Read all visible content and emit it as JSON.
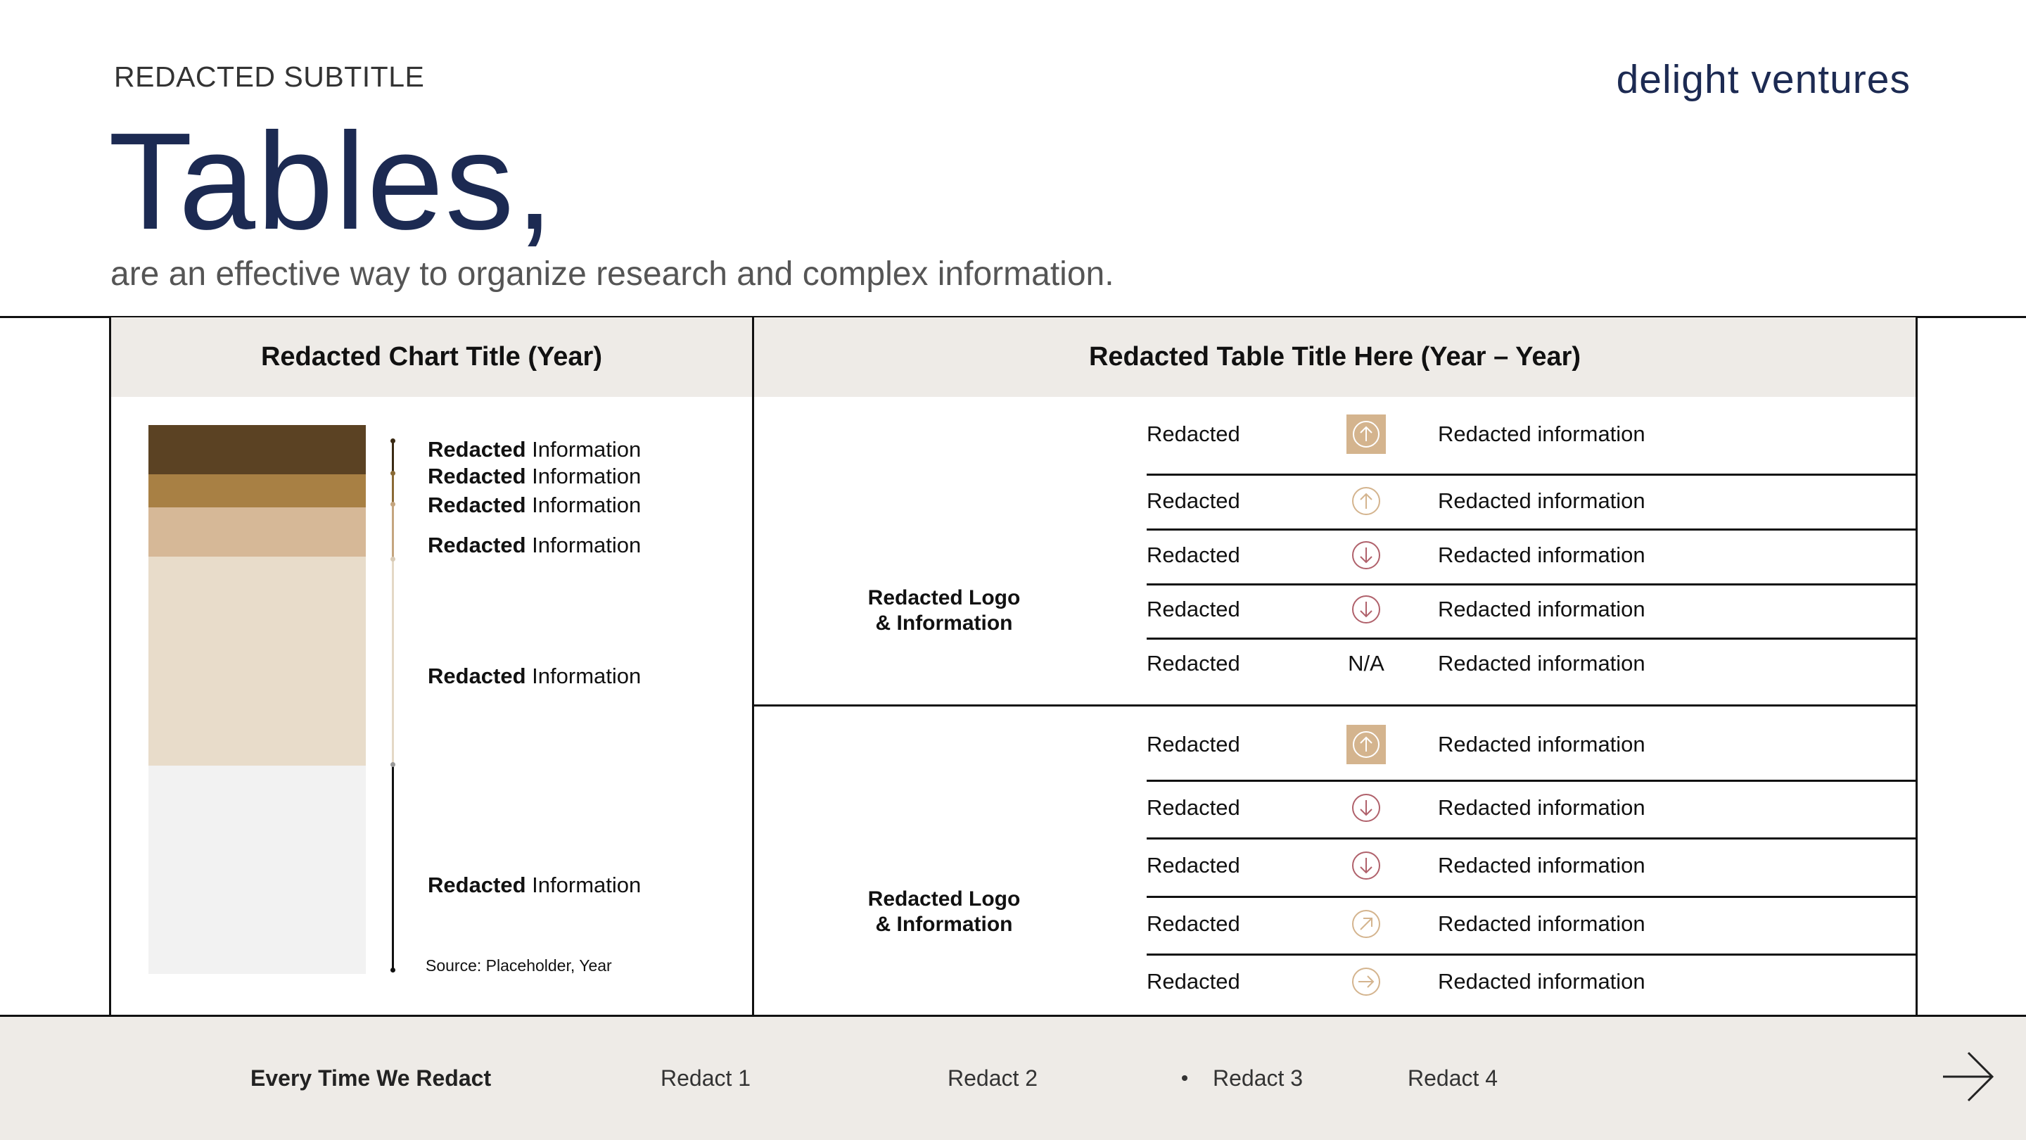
{
  "header": {
    "subtitle": "REDACTED SUBTITLE",
    "brand": "delight ventures",
    "title": "Tables,",
    "lede": "are an effective way to organize research and complex information."
  },
  "colors": {
    "navy": "#1c2a52",
    "panel": "#eeebe7",
    "dark_brown": "#5b4223",
    "brown": "#a88044",
    "tan": "#d6b897",
    "beige": "#e8dcca",
    "light_gray": "#f2f2f2",
    "down_red": "#b0616b",
    "up_gold": "#d4b48e"
  },
  "chart_panel": {
    "title": "Redacted Chart Title (Year)",
    "source": "Source: Placeholder, Year"
  },
  "chart_data": {
    "type": "bar",
    "categories": [
      "Redacted Information",
      "Redacted Information",
      "Redacted Information",
      "Redacted Information",
      "Redacted Information",
      "Redacted Information"
    ],
    "series": [
      {
        "values": [
          9,
          6,
          9,
          38,
          38
        ]
      }
    ],
    "stacked": true,
    "labels": [
      {
        "bold": "Redacted",
        "rest": " Information"
      },
      {
        "bold": "Redacted",
        "rest": " Information"
      },
      {
        "bold": "Redacted",
        "rest": " Information"
      },
      {
        "bold": "Redacted",
        "rest": " Information"
      },
      {
        "bold": "Redacted",
        "rest": " Information"
      },
      {
        "bold": "Redacted",
        "rest": " Information"
      }
    ]
  },
  "table_panel": {
    "title": "Redacted Table Title Here (Year – Year)",
    "groups": [
      {
        "logo_line1": "Redacted Logo",
        "logo_line2": "& Information",
        "rows": [
          {
            "name": "Redacted",
            "icon": "arrow-up-filled-icon",
            "info": "Redacted information"
          },
          {
            "name": "Redacted",
            "icon": "arrow-up-outline-icon",
            "info": "Redacted information"
          },
          {
            "name": "Redacted",
            "icon": "arrow-down-icon",
            "info": "Redacted information"
          },
          {
            "name": "Redacted",
            "icon": "arrow-down-icon",
            "info": "Redacted information"
          },
          {
            "name": "Redacted",
            "icon": "none",
            "na": "N/A",
            "info": "Redacted information"
          }
        ]
      },
      {
        "logo_line1": "Redacted Logo",
        "logo_line2": "& Information",
        "rows": [
          {
            "name": "Redacted",
            "icon": "arrow-up-filled-icon",
            "info": "Redacted information"
          },
          {
            "name": "Redacted",
            "icon": "arrow-down-icon",
            "info": "Redacted information"
          },
          {
            "name": "Redacted",
            "icon": "arrow-down-icon",
            "info": "Redacted information"
          },
          {
            "name": "Redacted",
            "icon": "arrow-up-right-icon",
            "info": "Redacted information"
          },
          {
            "name": "Redacted",
            "icon": "arrow-right-icon",
            "info": "Redacted information"
          }
        ]
      }
    ]
  },
  "footer": {
    "label": "Every Time We Redact",
    "items": [
      "Redact 1",
      "Redact 2",
      "Redact 3",
      "Redact 4"
    ],
    "active_index": 2,
    "next_icon": "arrow-right-icon"
  }
}
